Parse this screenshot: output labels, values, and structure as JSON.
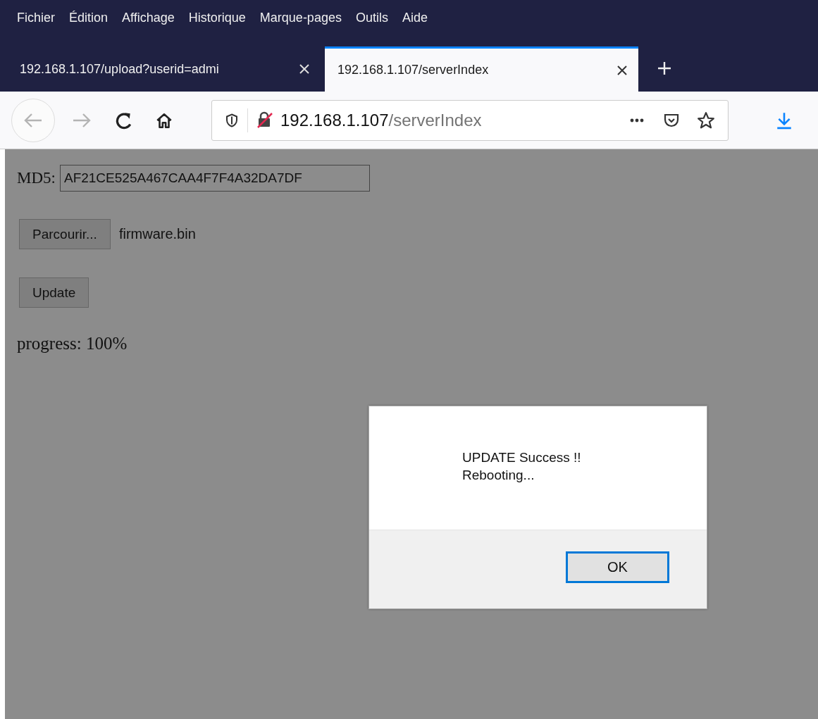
{
  "menu": [
    "Fichier",
    "Édition",
    "Affichage",
    "Historique",
    "Marque-pages",
    "Outils",
    "Aide"
  ],
  "tabs": [
    {
      "title": "192.168.1.107/upload?userid=admi",
      "selected": false
    },
    {
      "title": "192.168.1.107/serverIndex",
      "selected": true
    }
  ],
  "address": {
    "host": "192.168.1.107",
    "path": "/serverIndex"
  },
  "page": {
    "md5_label": "MD5:",
    "md5_value": "AF21CE525A467CAA4F7F4A32DA7DF",
    "browse_button": "Parcourir...",
    "file_name": "firmware.bin",
    "update_button": "Update",
    "progress": "progress: 100%"
  },
  "dialog": {
    "message": "UPDATE Success !!\nRebooting...",
    "button": "OK"
  }
}
